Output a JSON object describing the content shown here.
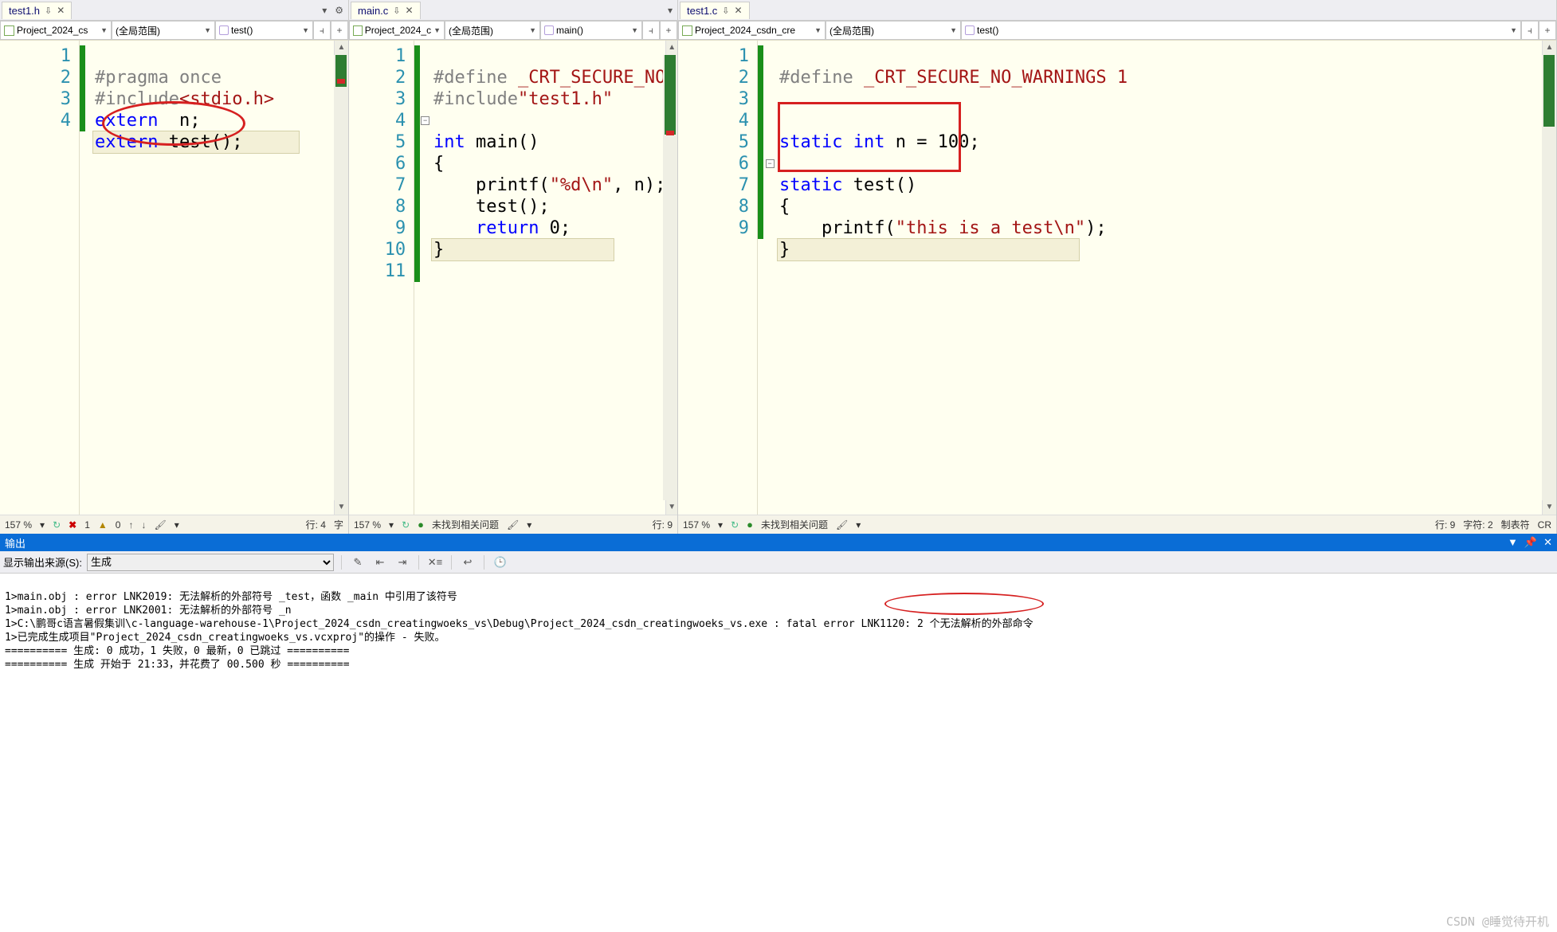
{
  "pane1": {
    "tab": "test1.h",
    "project": "Project_2024_cs",
    "scope": "(全局范围)",
    "func": "test()",
    "lines": [
      "1",
      "2",
      "3",
      "4"
    ],
    "code": {
      "l1_pp": "#pragma once",
      "l2_pp": "#include",
      "l2_inc": "<stdio.h>",
      "l3_kw": "extern",
      "l3_rest": "  n;",
      "l4_kw": "extern",
      "l4_rest": " test();"
    },
    "status": {
      "zoom": "157 %",
      "err": "1",
      "warn": "0",
      "line": "行: 4",
      "char": "字"
    }
  },
  "pane2": {
    "tab": "main.c",
    "project": "Project_2024_c",
    "scope": "(全局范围)",
    "func": "main()",
    "lines": [
      "1",
      "2",
      "3",
      "4",
      "5",
      "6",
      "7",
      "8",
      "9",
      "10",
      "11"
    ],
    "code": {
      "l1_pp": "#define",
      "l1_rest": " _CRT_SECURE_NO",
      "l2_pp": "#include",
      "l2_inc": "\"test1.h\"",
      "l4_kw": "int",
      "l4_rest": " main()",
      "l5": "{",
      "l6_a": "    printf(",
      "l6_str": "\"%d\\n\"",
      "l6_b": ", n);",
      "l7": "    test();",
      "l8_kw": "    return",
      "l8_rest": " 0;",
      "l9": "}"
    },
    "status": {
      "zoom": "157 %",
      "msg": "未找到相关问题",
      "line": "行: 9"
    }
  },
  "pane3": {
    "tab": "test1.c",
    "project": "Project_2024_csdn_cre",
    "scope": "(全局范围)",
    "func": "test()",
    "lines": [
      "1",
      "2",
      "3",
      "4",
      "5",
      "6",
      "7",
      "8",
      "9"
    ],
    "code": {
      "l1_pp": "#define",
      "l1_rest": " _CRT_SECURE_NO_WARNINGS 1",
      "l4_kw": "static int",
      "l4_rest": " n = 100;",
      "l6_kw": "static",
      "l6_rest": " test()",
      "l7": "{",
      "l8_a": "    printf(",
      "l8_str": "\"this is a test\\n\"",
      "l8_b": ");",
      "l9": "}"
    },
    "status": {
      "zoom": "157 %",
      "msg": "未找到相关问题",
      "line": "行: 9",
      "char": "字符: 2",
      "tab": "制表符",
      "cr": "CR"
    }
  },
  "output": {
    "header": "输出",
    "source_label": "显示输出来源(S):",
    "source_value": "生成",
    "lines": [
      "1>main.obj : error LNK2019: 无法解析的外部符号 _test，函数 _main 中引用了该符号",
      "1>main.obj : error LNK2001: 无法解析的外部符号 _n",
      "1>C:\\鹏哥c语言暑假集训\\c-language-warehouse-1\\Project_2024_csdn_creatingwoeks_vs\\Debug\\Project_2024_csdn_creatingwoeks_vs.exe : fatal error LNK1120: 2 个无法解析的外部命令",
      "1>已完成生成项目\"Project_2024_csdn_creatingwoeks_vs.vcxproj\"的操作 - 失败。",
      "========== 生成: 0 成功，1 失败，0 最新，0 已跳过 ==========",
      "========== 生成 开始于 21:33，并花费了 00.500 秒 =========="
    ],
    "watermark": "CSDN @睡觉待开机"
  }
}
